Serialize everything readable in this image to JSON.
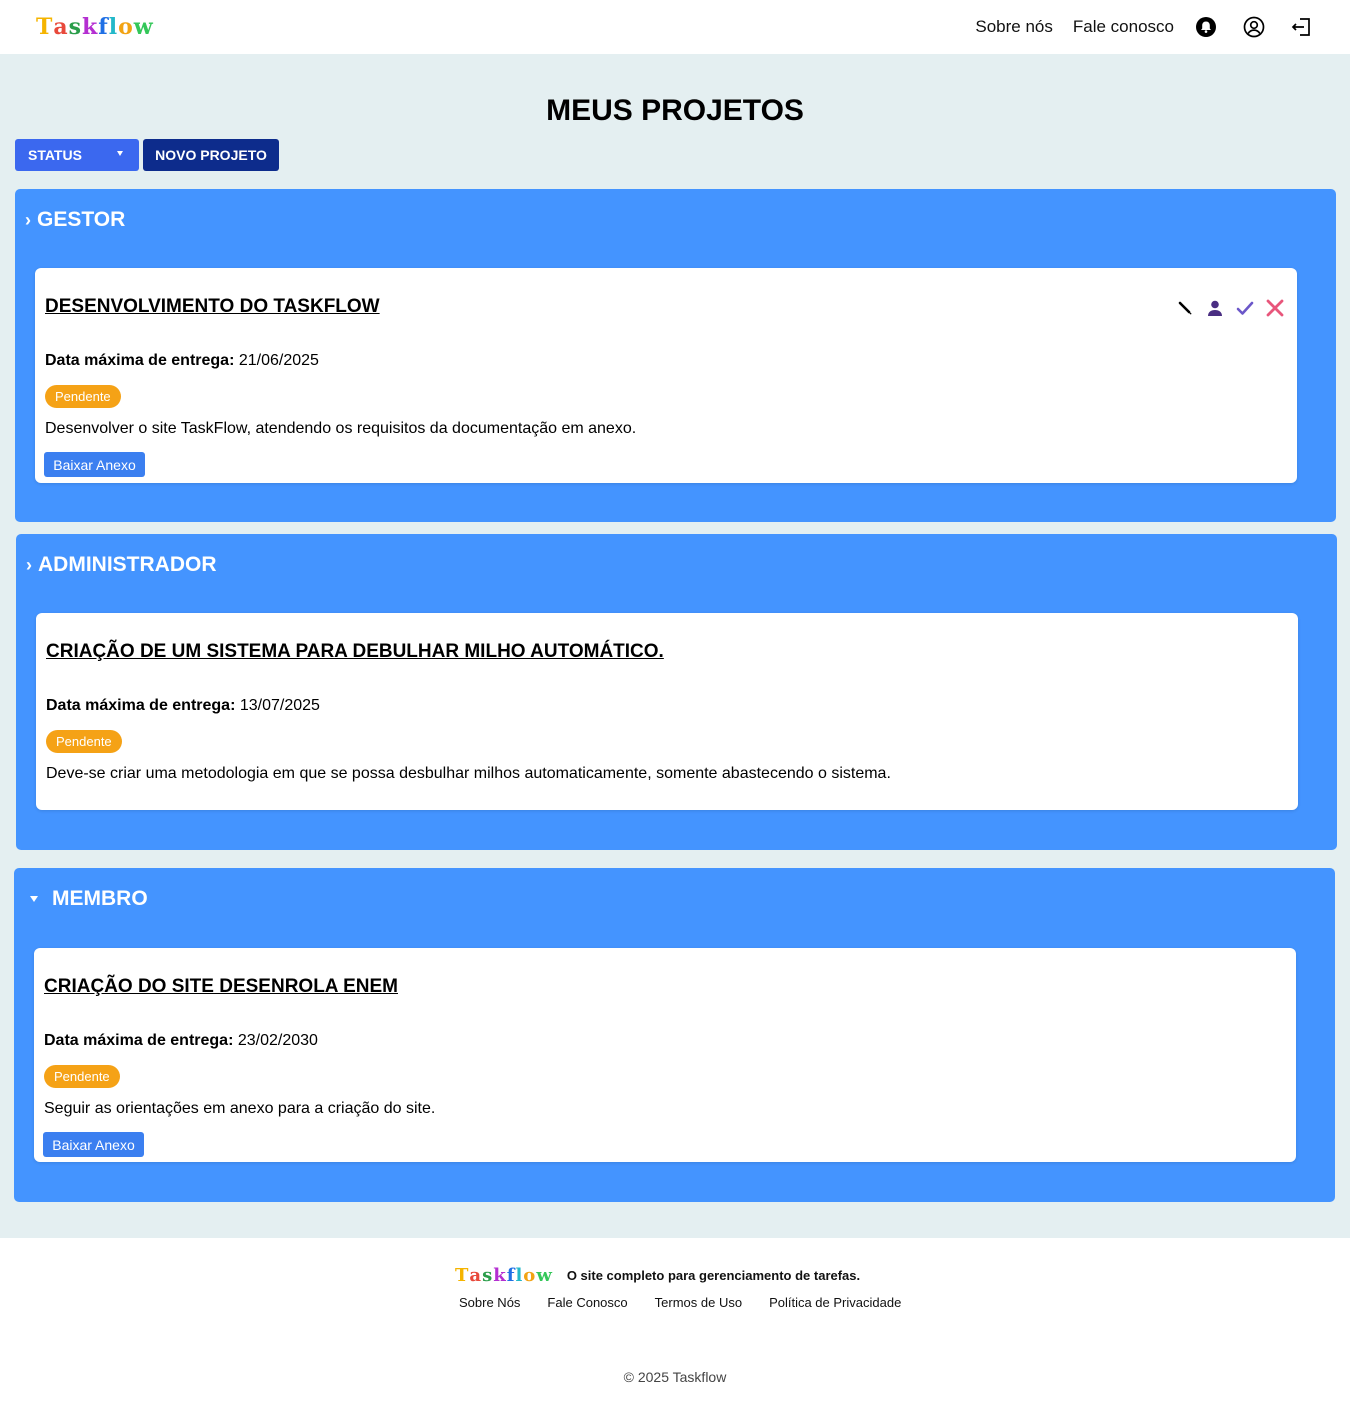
{
  "brand": {
    "letters": [
      "T",
      "a",
      "s",
      "k",
      "f",
      "l",
      "o",
      "w"
    ],
    "letter_colors": [
      "#f5b400",
      "#e8493b",
      "#2a9d4a",
      "#b42fd1",
      "#1f6fe5",
      "#22b8c9",
      "#f2a313",
      "#34c759"
    ]
  },
  "header": {
    "nav": [
      "Sobre nós",
      "Fale conosco"
    ],
    "icons": [
      "bell-icon",
      "user-icon",
      "logout-icon"
    ]
  },
  "page": {
    "title": "MEUS PROJETOS",
    "status_button": "STATUS",
    "new_project_button": "NOVO PROJETO"
  },
  "sections": [
    {
      "label": "GESTOR",
      "marker": "›",
      "project": {
        "title": "DESENVOLVIMENTO DO TASKFLOW",
        "date_label": "Data máxima de entrega:",
        "date": "21/06/2025",
        "status": "Pendente",
        "description": "Desenvolver o site TaskFlow, atendendo os requisitos da documentação em anexo.",
        "download": "Baixar Anexo",
        "actions": [
          "edit-icon",
          "user-icon",
          "check-icon",
          "close-icon"
        ]
      }
    },
    {
      "label": "ADMINISTRADOR",
      "marker": "›",
      "project": {
        "title": "CRIAÇÃO DE UM SISTEMA PARA DEBULHAR MILHO AUTOMÁTICO.",
        "date_label": "Data máxima de entrega:",
        "date": "13/07/2025",
        "status": "Pendente",
        "description": "Deve-se criar uma metodologia em que se possa desbulhar milhos automaticamente, somente abastecendo o sistema."
      }
    },
    {
      "label": "MEMBRO",
      "marker": "▾",
      "project": {
        "title": "CRIAÇÃO DO SITE DESENROLA ENEM",
        "date_label": "Data máxima de entrega:",
        "date": "23/02/2030",
        "status": "Pendente",
        "description": "Seguir as orientações em anexo para a criação do site.",
        "download": "Baixar Anexo"
      }
    }
  ],
  "footer": {
    "tagline": "O site completo para gerenciamento de tarefas.",
    "links": [
      "Sobre Nós",
      "Fale Conosco",
      "Termos de Uso",
      "Política de Privacidade"
    ],
    "copyright": "© 2025 Taskflow"
  },
  "colors": {
    "section_bg": "#4494ff",
    "main_bg": "#e4eff1",
    "status_button": "#3b68ef",
    "new_button": "#0d2c8c",
    "badge_pending": "#f5a216",
    "download_button": "#3b7ff0"
  }
}
